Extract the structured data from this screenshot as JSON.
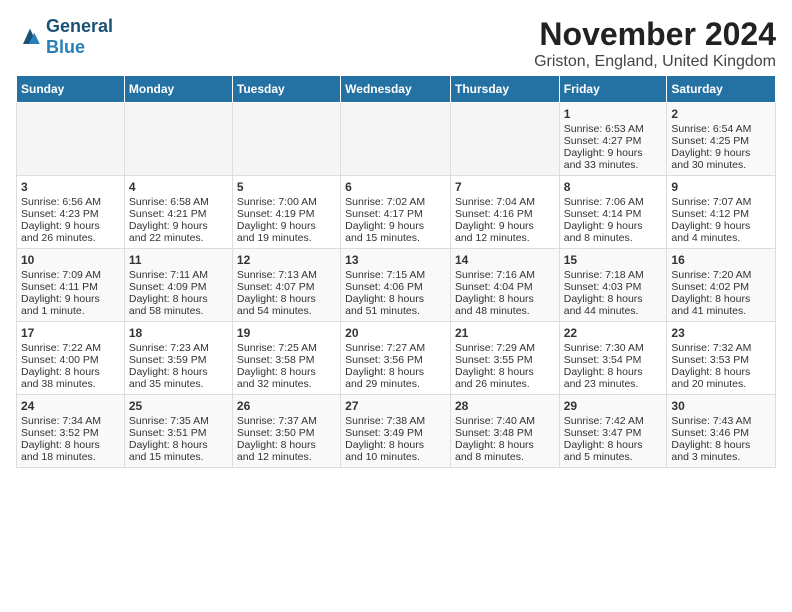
{
  "header": {
    "logo_general": "General",
    "logo_blue": "Blue",
    "month_title": "November 2024",
    "location": "Griston, England, United Kingdom"
  },
  "weekdays": [
    "Sunday",
    "Monday",
    "Tuesday",
    "Wednesday",
    "Thursday",
    "Friday",
    "Saturday"
  ],
  "weeks": [
    [
      {
        "day": "",
        "info": ""
      },
      {
        "day": "",
        "info": ""
      },
      {
        "day": "",
        "info": ""
      },
      {
        "day": "",
        "info": ""
      },
      {
        "day": "",
        "info": ""
      },
      {
        "day": "1",
        "info": "Sunrise: 6:53 AM\nSunset: 4:27 PM\nDaylight: 9 hours\nand 33 minutes."
      },
      {
        "day": "2",
        "info": "Sunrise: 6:54 AM\nSunset: 4:25 PM\nDaylight: 9 hours\nand 30 minutes."
      }
    ],
    [
      {
        "day": "3",
        "info": "Sunrise: 6:56 AM\nSunset: 4:23 PM\nDaylight: 9 hours\nand 26 minutes."
      },
      {
        "day": "4",
        "info": "Sunrise: 6:58 AM\nSunset: 4:21 PM\nDaylight: 9 hours\nand 22 minutes."
      },
      {
        "day": "5",
        "info": "Sunrise: 7:00 AM\nSunset: 4:19 PM\nDaylight: 9 hours\nand 19 minutes."
      },
      {
        "day": "6",
        "info": "Sunrise: 7:02 AM\nSunset: 4:17 PM\nDaylight: 9 hours\nand 15 minutes."
      },
      {
        "day": "7",
        "info": "Sunrise: 7:04 AM\nSunset: 4:16 PM\nDaylight: 9 hours\nand 12 minutes."
      },
      {
        "day": "8",
        "info": "Sunrise: 7:06 AM\nSunset: 4:14 PM\nDaylight: 9 hours\nand 8 minutes."
      },
      {
        "day": "9",
        "info": "Sunrise: 7:07 AM\nSunset: 4:12 PM\nDaylight: 9 hours\nand 4 minutes."
      }
    ],
    [
      {
        "day": "10",
        "info": "Sunrise: 7:09 AM\nSunset: 4:11 PM\nDaylight: 9 hours\nand 1 minute."
      },
      {
        "day": "11",
        "info": "Sunrise: 7:11 AM\nSunset: 4:09 PM\nDaylight: 8 hours\nand 58 minutes."
      },
      {
        "day": "12",
        "info": "Sunrise: 7:13 AM\nSunset: 4:07 PM\nDaylight: 8 hours\nand 54 minutes."
      },
      {
        "day": "13",
        "info": "Sunrise: 7:15 AM\nSunset: 4:06 PM\nDaylight: 8 hours\nand 51 minutes."
      },
      {
        "day": "14",
        "info": "Sunrise: 7:16 AM\nSunset: 4:04 PM\nDaylight: 8 hours\nand 48 minutes."
      },
      {
        "day": "15",
        "info": "Sunrise: 7:18 AM\nSunset: 4:03 PM\nDaylight: 8 hours\nand 44 minutes."
      },
      {
        "day": "16",
        "info": "Sunrise: 7:20 AM\nSunset: 4:02 PM\nDaylight: 8 hours\nand 41 minutes."
      }
    ],
    [
      {
        "day": "17",
        "info": "Sunrise: 7:22 AM\nSunset: 4:00 PM\nDaylight: 8 hours\nand 38 minutes."
      },
      {
        "day": "18",
        "info": "Sunrise: 7:23 AM\nSunset: 3:59 PM\nDaylight: 8 hours\nand 35 minutes."
      },
      {
        "day": "19",
        "info": "Sunrise: 7:25 AM\nSunset: 3:58 PM\nDaylight: 8 hours\nand 32 minutes."
      },
      {
        "day": "20",
        "info": "Sunrise: 7:27 AM\nSunset: 3:56 PM\nDaylight: 8 hours\nand 29 minutes."
      },
      {
        "day": "21",
        "info": "Sunrise: 7:29 AM\nSunset: 3:55 PM\nDaylight: 8 hours\nand 26 minutes."
      },
      {
        "day": "22",
        "info": "Sunrise: 7:30 AM\nSunset: 3:54 PM\nDaylight: 8 hours\nand 23 minutes."
      },
      {
        "day": "23",
        "info": "Sunrise: 7:32 AM\nSunset: 3:53 PM\nDaylight: 8 hours\nand 20 minutes."
      }
    ],
    [
      {
        "day": "24",
        "info": "Sunrise: 7:34 AM\nSunset: 3:52 PM\nDaylight: 8 hours\nand 18 minutes."
      },
      {
        "day": "25",
        "info": "Sunrise: 7:35 AM\nSunset: 3:51 PM\nDaylight: 8 hours\nand 15 minutes."
      },
      {
        "day": "26",
        "info": "Sunrise: 7:37 AM\nSunset: 3:50 PM\nDaylight: 8 hours\nand 12 minutes."
      },
      {
        "day": "27",
        "info": "Sunrise: 7:38 AM\nSunset: 3:49 PM\nDaylight: 8 hours\nand 10 minutes."
      },
      {
        "day": "28",
        "info": "Sunrise: 7:40 AM\nSunset: 3:48 PM\nDaylight: 8 hours\nand 8 minutes."
      },
      {
        "day": "29",
        "info": "Sunrise: 7:42 AM\nSunset: 3:47 PM\nDaylight: 8 hours\nand 5 minutes."
      },
      {
        "day": "30",
        "info": "Sunrise: 7:43 AM\nSunset: 3:46 PM\nDaylight: 8 hours\nand 3 minutes."
      }
    ]
  ]
}
